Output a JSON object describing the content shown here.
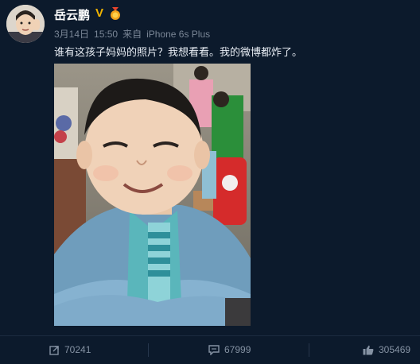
{
  "post": {
    "username": "岳云鹏",
    "verified_badge": "V",
    "date": "3月14日",
    "time": "15:50",
    "source_prefix": "来自",
    "device": "iPhone 6s Plus",
    "text": "谁有这孩子妈妈的照片？我想看看。我的微博都炸了。"
  },
  "actions": {
    "repost_count": "70241",
    "comment_count": "67999",
    "like_count": "305469"
  },
  "colors": {
    "background": "#0c1a2c",
    "verified_badge": "#f0b400",
    "meta_text": "#7a8696"
  },
  "icons": [
    "avatar",
    "verified-icon",
    "medal-icon",
    "repost-icon",
    "comment-icon",
    "like-icon"
  ]
}
